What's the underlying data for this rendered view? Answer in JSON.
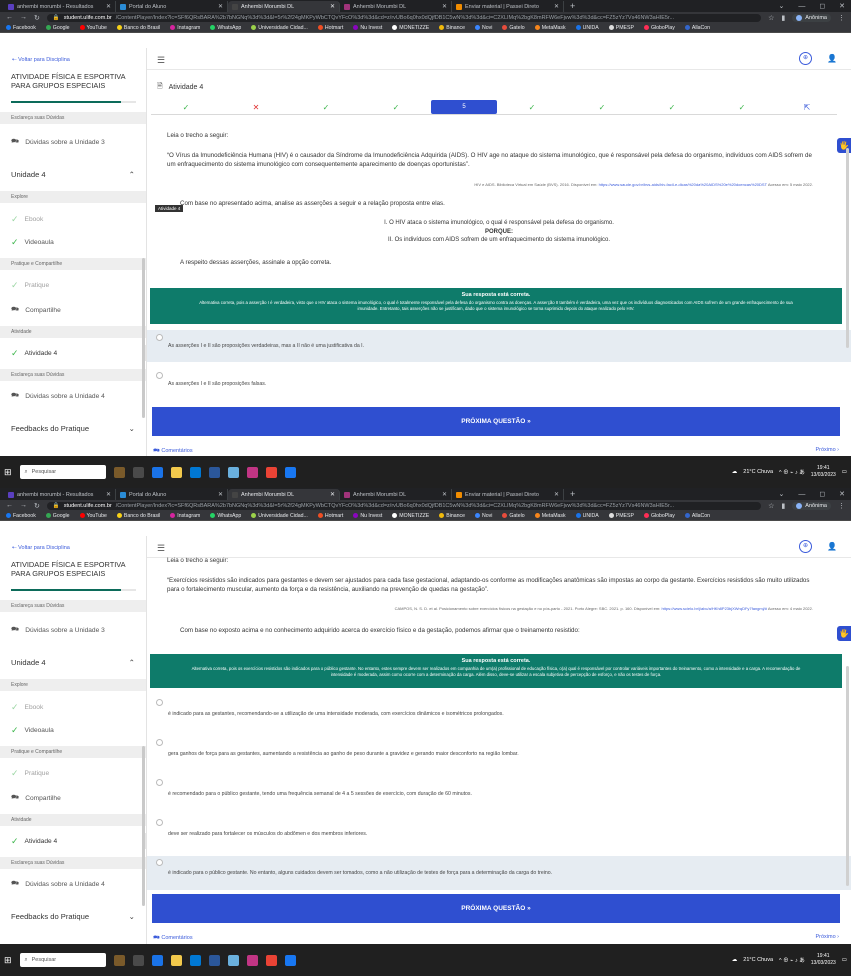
{
  "browser": {
    "tabs": [
      {
        "label": "anhembi morumbi - Resultados",
        "icon_color": "#5a3fc0"
      },
      {
        "label": "Portal do Aluno",
        "icon_color": "#2a8cd6"
      },
      {
        "label": "Anhembi Morumbi DL",
        "icon_color": "#444444"
      },
      {
        "label": "Anhembi Morumbi DL",
        "icon_color": "#a0337a"
      },
      {
        "label": "Enviar material | Passei Direto",
        "icon_color": "#f08c00"
      }
    ],
    "active_tab": 2,
    "new_tab": "+",
    "url_host": "student.ulife.com.br",
    "url_path": "/ContentPlayer/Index?lc=SFf6QRsBARA%2b7bNGNq%3d%3d&l=5r%2f24gMKPyWbCTQvYFcO%3d%3d&cd=z/rvUBo6q0hx0dQjfDB1C5wN%3d%3d&ci=C2XLIMq%2bgK8mRFW6eFjvw%3d%3d&cc=FZ5zYz7Vs46NW3aHIE5r..."
  },
  "profile_name": "Anônima",
  "bookmarks": [
    {
      "label": "Facebook",
      "color": "#1877f2"
    },
    {
      "label": "Google",
      "color": "#34a853"
    },
    {
      "label": "YouTube",
      "color": "#ff0000"
    },
    {
      "label": "Banco do Brasil",
      "color": "#f7d117"
    },
    {
      "label": "Instagram",
      "color": "#d6249f"
    },
    {
      "label": "WhatsApp",
      "color": "#25d366"
    },
    {
      "label": "Universidade Cidad...",
      "color": "#9bd14a"
    },
    {
      "label": "Hotmart",
      "color": "#f04e23"
    },
    {
      "label": "Nu Invest",
      "color": "#8a05be"
    },
    {
      "label": "MONETIZZE",
      "color": "#ffffff"
    },
    {
      "label": "Binance",
      "color": "#f0b90b"
    },
    {
      "label": "Novi",
      "color": "#3a86ff"
    },
    {
      "label": "Gatelo",
      "color": "#e74c3c"
    },
    {
      "label": "MetaMask",
      "color": "#f6851b"
    },
    {
      "label": "UNIDA",
      "color": "#1a73e8"
    },
    {
      "label": "PMESP",
      "color": "#dddddd"
    },
    {
      "label": "GloboPlay",
      "color": "#ff2d55"
    },
    {
      "label": "AllaCon",
      "color": "#3366cc"
    }
  ],
  "sidebar": {
    "back_link": "Voltar para Disciplina",
    "course_title": "ATIVIDADE FÍSICA E ESPORTIVA PARA GRUPOS ESPECIAIS",
    "progress": 0.88,
    "unit_title": "Unidade 4",
    "feedbacks": "Feedbacks do Pratique",
    "groups": {
      "doubts": "Esclareça suas Dúvidas",
      "explore": "Explore",
      "practice": "Pratique e Compartilhe",
      "activity": "Atividade",
      "doubts2": "Esclareça suas Dúvidas"
    },
    "items": {
      "doubts_unit3": "Dúvidas sobre a Unidade 3",
      "ebook": "Ebook",
      "videoaula": "Videoaula",
      "pratique": "Pratique",
      "compartilhe": "Compartilhe",
      "atividade4": "Atividade 4",
      "doubts_unit4": "Dúvidas sobre a Unidade 4"
    }
  },
  "activity": {
    "title": "Atividade 4",
    "tooltip": "Atividade 4",
    "question_nav": [
      {
        "label": "✓",
        "state": "ok"
      },
      {
        "label": "✕",
        "state": "bad"
      },
      {
        "label": "✓",
        "state": "ok"
      },
      {
        "label": "✓",
        "state": "ok"
      },
      {
        "label": "5",
        "state": "cur"
      },
      {
        "label": "✓",
        "state": "ok"
      },
      {
        "label": "✓",
        "state": "ok"
      },
      {
        "label": "✓",
        "state": "ok"
      },
      {
        "label": "✓",
        "state": "ok"
      },
      {
        "label": "⇱",
        "state": "last"
      }
    ]
  },
  "q1": {
    "intro": "Leia o trecho a seguir:",
    "quote": "“O Vírus da Imunodeficiência Humana (HIV) é o causador da Síndrome da Imunodeficiência Adquirida (AIDS). O HIV age no ataque do sistema imunológico, que é responsável pela defesa do organismo, indivíduos com AIDS sofrem de um enfraquecimento do sistema imunológico com consequentemente aparecimento de doenças oportunistas”.",
    "citation": "HIV e AIDS. Biblioteca Virtual em Saúde (BVS). 2016. Disponível em:",
    "citation_link": "https://www.saude.gov.br/bvs-aids/hiv-facil-e-dicas%20da%20AIDS%20e%20doencas%20DST",
    "citation_tail": "Acesso em: 5 maio 2022.",
    "prompt": "Com base no apresentado acima, analise as asserções a seguir e a relação proposta entre elas.",
    "assertion1": "I. O HIV ataca o sistema imunológico, o qual é responsável pela defesa do organismo.",
    "because": "PORQUE:",
    "assertion2": "II. Os indivíduos com AIDS sofrem de um enfraquecimento do sistema imunológico.",
    "ask": "A respeito dessas asserções, assinale a opção correta.",
    "feedback_title": "Sua resposta está correta.",
    "feedback_msg": "Alternativa correta, pois a asserção I é verdadeira, visto que o HIV ataca o sistema imunológico, o qual é totalmente responsável pela defesa do organismo contra as doenças. A asserção II também é verdadeira, uma vez que os indivíduos diagnosticados com AIDS sofrem de um grande enfraquecimento de sua imunidade. Entretanto, tais asserções não se justificam, dado que o sistema imunológico se torna suprimido depois do ataque realizado pelo HIV.",
    "options": [
      {
        "text": "As asserções I e II são proposições verdadeiras, mas a II não é uma justificativa da I.",
        "selected": true
      },
      {
        "text": "As asserções I e II são proposições falsas.",
        "selected": false
      }
    ]
  },
  "q2": {
    "intro": "Leia o trecho a seguir:",
    "quote": "“Exercícios resistidos são indicados para gestantes e devem ser ajustados para cada fase gestacional, adaptando-os conforme as modificações anatômicas são impostas ao corpo da gestante. Exercícios resistidos são muito utilizados para o fortalecimento muscular, aumento da força e da resistência, auxiliando na prevenção de quedas na gestação”.",
    "citation": "CAMPOS, N. S. D. et al. Posicionamento sobre exercícios físicos na gestação e no pós-parto - 2021. Porto Alegre: SBC. 2021. p. 160. Disponível em:",
    "citation_link": "https://www.scielo.br/j/abc/a/HKh8P23bjXWrqDFy7fangmj/#",
    "citation_tail": "Acesso em: 4 maio 2022.",
    "prompt": "Com base no exposto acima e no conhecimento adquirido acerca do exercício físico e da gestação, podemos afirmar que o treinamento resistido:",
    "feedback_title": "Sua resposta está correta.",
    "feedback_msg": "Alternativa correta, pois os exercícios resistidos são indicados para o público gestante. No entanto, estes sempre devem ser realizados em companhia de um(a) profissional de educação física, o(a) qual é responsável por controlar variáveis importantes do treinamento, como a intensidade e a carga. A recomendação de intensidade é moderada, assim como ocorre com a determinação da carga. Além disso, deve-se utilizar a escala subjetiva de percepção de esforço, e não os testes de força.",
    "options": [
      {
        "text": "é indicado para as gestantes, recomendando-se a utilização de uma intensidade moderada, com exercícios dinâmicos e isométricos prolongados.",
        "selected": false
      },
      {
        "text": "gera ganhos de força para as gestantes, aumentando a resistência ao ganho de peso durante a gravidez e gerando maior desconforto na região lombar.",
        "selected": false
      },
      {
        "text": "é recomendado para o público gestante, tendo uma frequência semanal de 4 a 5 sessões de exercício, com duração de 60 minutos.",
        "selected": false
      },
      {
        "text": "deve ser realizado para fortalecer os músculos do abdômen e dos membros inferiores.",
        "selected": false
      },
      {
        "text": "é indicado para o público gestante. No entanto, alguns cuidados devem ser tomados, como a não utilização de testes de força para a determinação da carga do treino.",
        "selected": true
      }
    ]
  },
  "next_button": "PRÓXIMA QUESTÃO »",
  "comments": "Comentários",
  "next_link": "Próximo",
  "taskbar": {
    "search": "Pesquisar",
    "weather": "21°C Chuva",
    "time": "19:41",
    "date": "13/03/2023"
  }
}
